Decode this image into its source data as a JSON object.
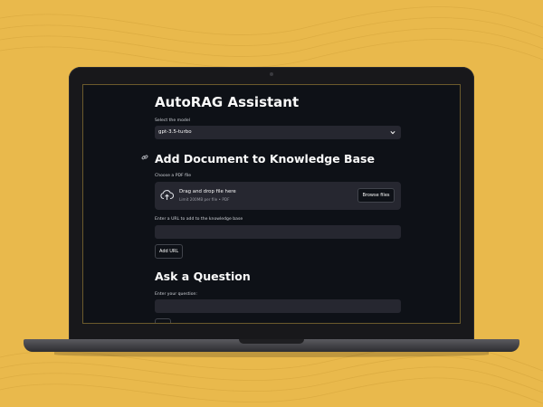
{
  "app": {
    "title": "AutoRAG Assistant",
    "model": {
      "label": "Select the model",
      "selected": "gpt-3.5-turbo"
    },
    "document_section": {
      "heading": "Add Document to Knowledge Base",
      "file_label": "Choose a PDF file",
      "dropzone_text": "Drag and drop file here",
      "dropzone_limit": "Limit 200MB per file • PDF",
      "browse_label": "Browse files",
      "url_label": "Enter a URL to add to the knowledge base",
      "url_value": "",
      "add_url_label": "Add URL"
    },
    "question_section": {
      "heading": "Ask a Question",
      "question_label": "Enter your question:",
      "question_value": ""
    }
  },
  "colors": {
    "background": "#e9b94c",
    "app_bg": "#0e1117",
    "widget_bg": "#262730",
    "text": "#fafafa"
  }
}
